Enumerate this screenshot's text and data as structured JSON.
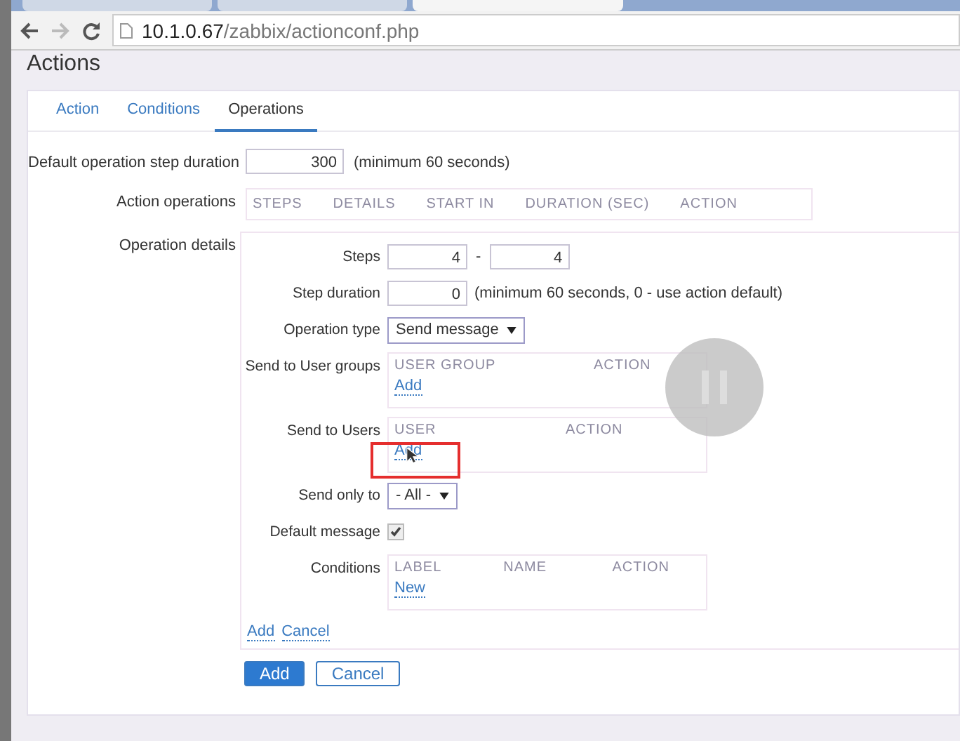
{
  "browser": {
    "tabs": [
      {
        "selected": false
      },
      {
        "selected": false
      },
      {
        "selected": true
      }
    ],
    "address": {
      "host": "10.1.0.67",
      "path": "/zabbix/actionconf.php"
    }
  },
  "page_title": "Actions",
  "tabs": [
    {
      "label": "Action",
      "selected": false
    },
    {
      "label": "Conditions",
      "selected": false
    },
    {
      "label": "Operations",
      "selected": true
    }
  ],
  "default_step_duration": {
    "label": "Default operation step duration",
    "value": "300",
    "hint": "(minimum 60 seconds)"
  },
  "action_operations": {
    "label": "Action operations",
    "columns": [
      "STEPS",
      "DETAILS",
      "START IN",
      "DURATION (SEC)",
      "ACTION"
    ]
  },
  "operation_details": {
    "label": "Operation details",
    "steps": {
      "label": "Steps",
      "from": "4",
      "separator": "-",
      "to": "4"
    },
    "step_duration": {
      "label": "Step duration",
      "value": "0",
      "hint": "(minimum 60 seconds, 0 - use action default)"
    },
    "operation_type": {
      "label": "Operation type",
      "value": "Send message"
    },
    "user_groups": {
      "label": "Send to User groups",
      "columns": [
        "USER GROUP",
        "ACTION"
      ],
      "link": "Add"
    },
    "users": {
      "label": "Send to Users",
      "columns": [
        "USER",
        "ACTION"
      ],
      "link": "Add"
    },
    "send_only_to": {
      "label": "Send only to",
      "value": "- All -"
    },
    "default_message": {
      "label": "Default message",
      "checked": true
    },
    "conditions": {
      "label": "Conditions",
      "columns": [
        "LABEL",
        "NAME",
        "ACTION"
      ],
      "link": "New"
    },
    "links": [
      "Add",
      "Cancel"
    ]
  },
  "buttons": [
    {
      "label": "Add",
      "primary": true
    },
    {
      "label": "Cancel",
      "primary": false
    }
  ]
}
